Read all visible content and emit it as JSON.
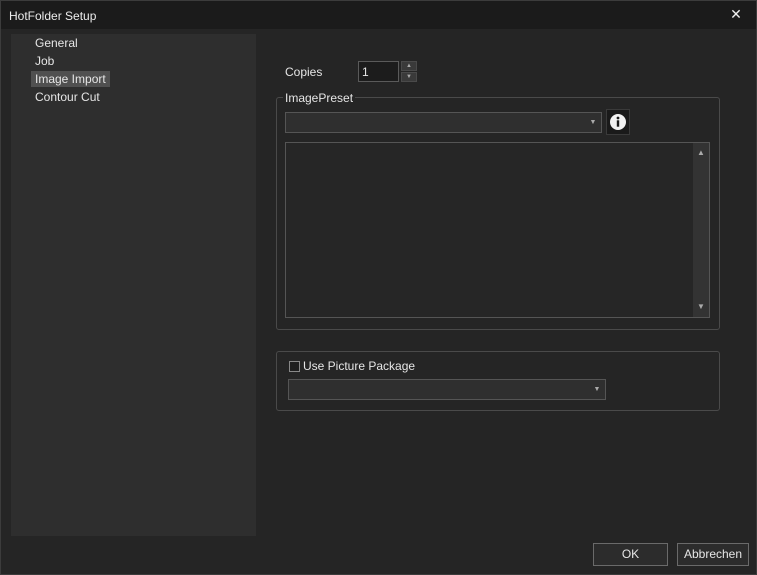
{
  "window": {
    "title": "HotFolder Setup",
    "close_glyph": "✕"
  },
  "nav": {
    "items": [
      {
        "label": "General"
      },
      {
        "label": "Job"
      },
      {
        "label": "Image Import",
        "selected": true
      },
      {
        "label": "Contour Cut"
      }
    ]
  },
  "copies": {
    "label": "Copies",
    "value": "1"
  },
  "image_preset": {
    "group_label": "ImagePreset",
    "selected": "",
    "info_icon": "info-icon"
  },
  "picture_package": {
    "checkbox_label": "Use Picture Package",
    "checked": false,
    "selected": ""
  },
  "footer": {
    "ok_label": "OK",
    "cancel_label": "Abbrechen"
  },
  "colors": {
    "background": "#252525",
    "titlebar": "#1b1b1b",
    "nav_bg": "#2e2e2e",
    "text": "#e6e6e6"
  }
}
